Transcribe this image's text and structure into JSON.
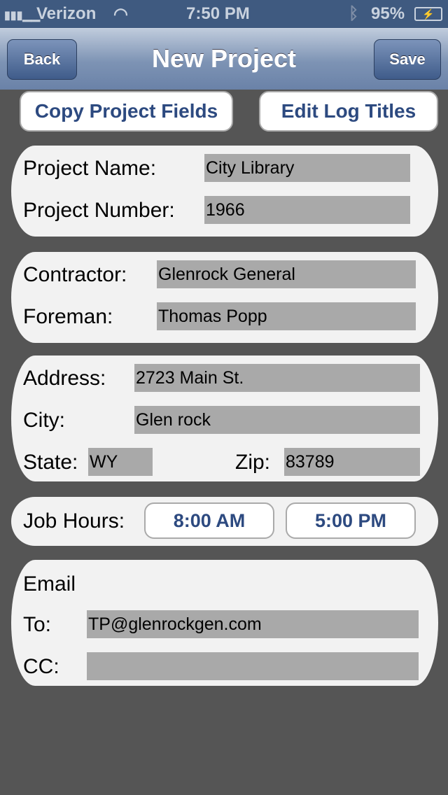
{
  "status": {
    "carrier": "Verizon",
    "time": "7:50 PM",
    "battery": "95%"
  },
  "nav": {
    "back": "Back",
    "title": "New Project",
    "save": "Save"
  },
  "actions": {
    "copy": "Copy Project Fields",
    "edit": "Edit Log Titles"
  },
  "project": {
    "name_label": "Project Name:",
    "name": "City Library",
    "number_label": "Project Number:",
    "number": "1966"
  },
  "crew": {
    "contractor_label": "Contractor:",
    "contractor": "Glenrock General",
    "foreman_label": "Foreman:",
    "foreman": "Thomas Popp"
  },
  "address": {
    "address_label": "Address:",
    "address": "2723 Main St.",
    "city_label": "City:",
    "city": "Glen rock",
    "state_label": "State:",
    "state": "WY",
    "zip_label": "Zip:",
    "zip": "83789"
  },
  "hours": {
    "label": "Job Hours:",
    "start": "8:00 AM",
    "end": "5:00 PM"
  },
  "email": {
    "heading": "Email",
    "to_label": "To:",
    "to": "TP@glenrockgen.com",
    "cc_label": "CC:",
    "cc": ""
  }
}
